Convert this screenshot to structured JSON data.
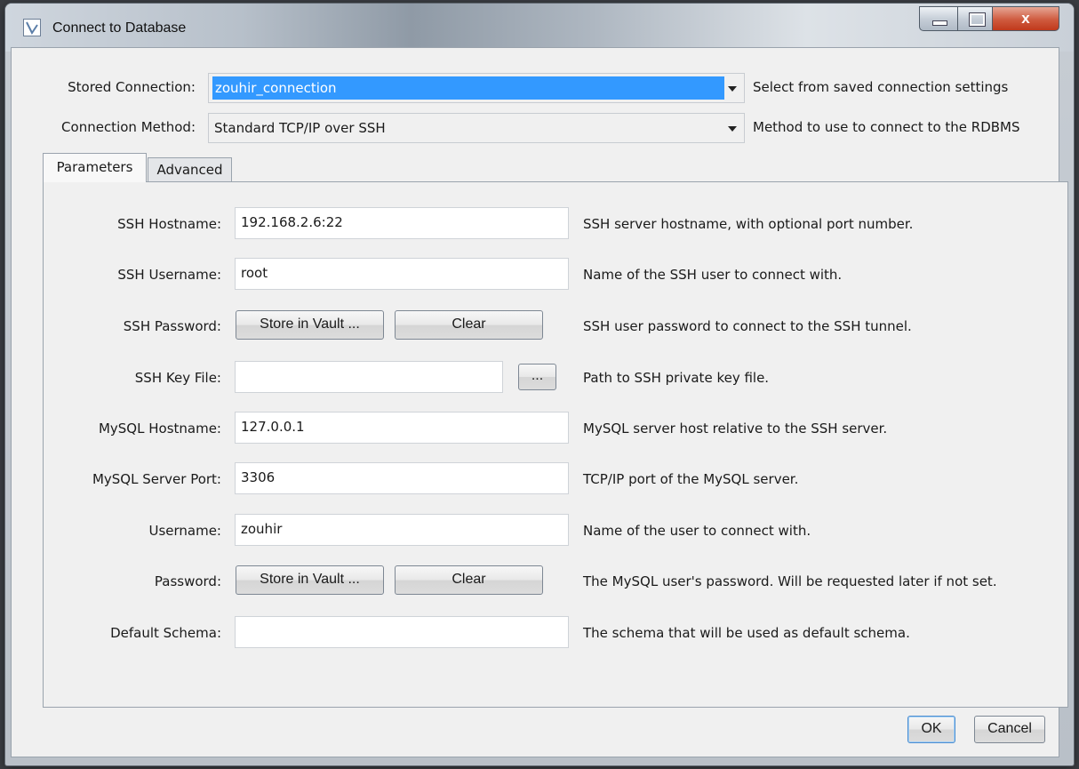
{
  "window": {
    "title": "Connect to Database",
    "close_label": "x"
  },
  "top_rows": [
    {
      "label": "Stored Connection:",
      "value": "zouhir_connection",
      "hint": "Select from saved connection settings"
    },
    {
      "label": "Connection Method:",
      "value": "Standard TCP/IP over SSH",
      "hint": "Method to use to connect to the RDBMS"
    }
  ],
  "tabs": [
    {
      "label": "Parameters",
      "active": true
    },
    {
      "label": "Advanced",
      "active": false
    }
  ],
  "params": {
    "ssh_hostname": {
      "label": "SSH Hostname:",
      "value": "192.168.2.6:22",
      "hint": "SSH server hostname, with optional port number."
    },
    "ssh_username": {
      "label": "SSH Username:",
      "value": "root",
      "hint": "Name of the SSH user to connect with."
    },
    "ssh_password": {
      "label": "SSH Password:",
      "store": "Store in Vault ...",
      "clear": "Clear",
      "hint": "SSH user password to connect to the SSH tunnel."
    },
    "ssh_keyfile": {
      "label": "SSH Key File:",
      "value": "",
      "browse": "...",
      "hint": "Path to SSH private key file."
    },
    "mysql_hostname": {
      "label": "MySQL Hostname:",
      "value": "127.0.0.1",
      "hint": "MySQL server host relative to the SSH server."
    },
    "mysql_port": {
      "label": "MySQL Server Port:",
      "value": "3306",
      "hint": "TCP/IP port of the MySQL server."
    },
    "username": {
      "label": "Username:",
      "value": "zouhir",
      "hint": "Name of the user to connect with."
    },
    "password": {
      "label": "Password:",
      "store": "Store in Vault ...",
      "clear": "Clear",
      "hint": "The MySQL user's password. Will be requested later if not set."
    },
    "default_schema": {
      "label": "Default Schema:",
      "value": "",
      "hint": "The schema that will be used as default schema."
    }
  },
  "footer": {
    "ok": "OK",
    "cancel": "Cancel"
  }
}
